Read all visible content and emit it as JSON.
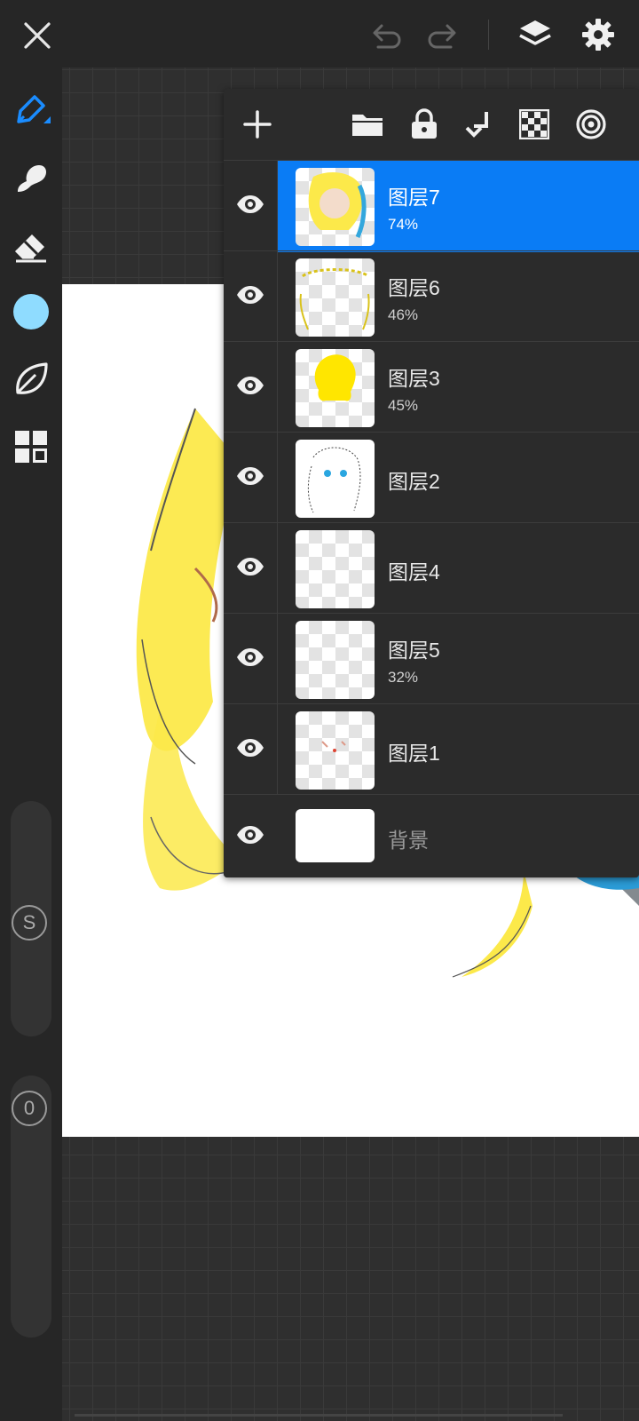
{
  "toolbar": {
    "close_icon": "close-icon",
    "undo_icon": "undo-icon",
    "redo_icon": "redo-icon",
    "layers_icon": "layers-icon",
    "settings_icon": "gear-icon"
  },
  "tools": [
    {
      "name": "pen",
      "icon": "pen-icon"
    },
    {
      "name": "smudge",
      "icon": "smudge-icon"
    },
    {
      "name": "eraser",
      "icon": "eraser-icon"
    },
    {
      "name": "color",
      "icon": "color-swatch",
      "color": "#8fdcff"
    },
    {
      "name": "brush-library",
      "icon": "leaf-icon"
    },
    {
      "name": "panels",
      "icon": "grid-icon"
    }
  ],
  "sliders": {
    "size_label": "S",
    "opacity_label": "0"
  },
  "layer_panel": {
    "actions": [
      "add-icon",
      "folder-icon",
      "lock-icon",
      "merge-down-icon",
      "transparency-icon",
      "blend-mode-icon"
    ],
    "accent": "#0a7cf5",
    "layers": [
      {
        "name": "图层7",
        "opacity": "74%",
        "selected": true
      },
      {
        "name": "图层6",
        "opacity": "46%"
      },
      {
        "name": "图层3",
        "opacity": "45%"
      },
      {
        "name": "图层2",
        "opacity": ""
      },
      {
        "name": "图层4",
        "opacity": ""
      },
      {
        "name": "图层5",
        "opacity": "32%"
      },
      {
        "name": "图层1",
        "opacity": ""
      },
      {
        "name": "背景",
        "opacity": "",
        "background": true
      }
    ]
  }
}
